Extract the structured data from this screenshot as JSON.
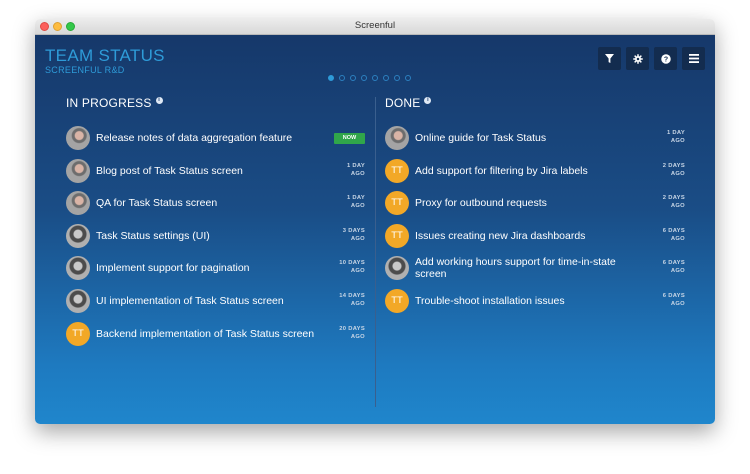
{
  "window": {
    "title": "Screenful"
  },
  "header": {
    "title": "TEAM STATUS",
    "subtitle": "SCREENFUL R&D",
    "page_dots": {
      "count": 8,
      "active": 0
    }
  },
  "toolbar": {
    "buttons": [
      {
        "icon": "filter-icon",
        "glyph": "▼"
      },
      {
        "icon": "gear-icon",
        "glyph": "⚙"
      },
      {
        "icon": "help-icon",
        "glyph": "?"
      },
      {
        "icon": "menu-icon",
        "glyph": "≡"
      }
    ]
  },
  "colors": {
    "accent": "#2e9bd8",
    "now_badge": "#30a64a",
    "tt_avatar": "#f2a827",
    "toolbar_button": "#132c4f"
  },
  "in_progress": {
    "heading": "IN PROGRESS",
    "items": [
      {
        "avatar": "photo",
        "text": "Release notes of data aggregation feature",
        "badge": "NOW"
      },
      {
        "avatar": "photo",
        "text": "Blog post of Task Status screen",
        "age_line1": "1 DAY",
        "age_line2": "AGO"
      },
      {
        "avatar": "photo",
        "text": "QA for Task Status screen",
        "age_line1": "1 DAY",
        "age_line2": "AGO"
      },
      {
        "avatar": "photo2",
        "text": "Task Status settings (UI)",
        "age_line1": "3 DAYS",
        "age_line2": "AGO"
      },
      {
        "avatar": "photo2",
        "text": "Implement support for pagination",
        "age_line1": "10 DAYS",
        "age_line2": "AGO"
      },
      {
        "avatar": "photo2",
        "text": "UI implementation of Task Status screen",
        "age_line1": "14 DAYS",
        "age_line2": "AGO"
      },
      {
        "avatar": "TT",
        "text": "Backend implementation of Task Status screen",
        "age_line1": "20 DAYS",
        "age_line2": "AGO"
      }
    ]
  },
  "done": {
    "heading": "DONE",
    "items": [
      {
        "avatar": "photo",
        "text": "Online guide for Task Status",
        "age_line1": "1 DAY",
        "age_line2": "AGO"
      },
      {
        "avatar": "TT",
        "text": "Add support for filtering by Jira labels",
        "age_line1": "2 DAYS",
        "age_line2": "AGO"
      },
      {
        "avatar": "TT",
        "text": "Proxy for outbound requests",
        "age_line1": "2 DAYS",
        "age_line2": "AGO"
      },
      {
        "avatar": "TT",
        "text": "Issues creating new Jira dashboards",
        "age_line1": "6 DAYS",
        "age_line2": "AGO"
      },
      {
        "avatar": "photo2",
        "text": "Add working hours support for time-in-state screen",
        "age_line1": "6 DAYS",
        "age_line2": "AGO"
      },
      {
        "avatar": "TT",
        "text": "Trouble-shoot installation issues",
        "age_line1": "6 DAYS",
        "age_line2": "AGO"
      }
    ]
  }
}
